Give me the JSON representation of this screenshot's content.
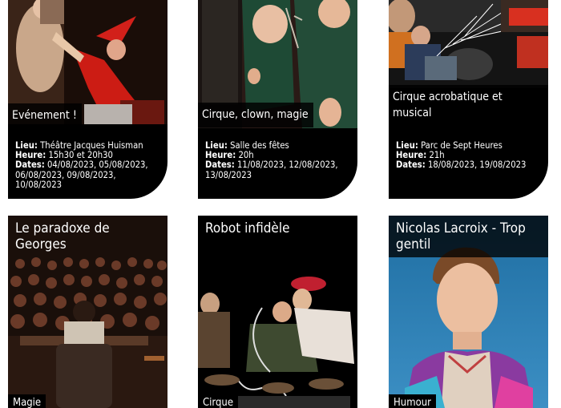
{
  "cards_top": [
    {
      "category": "Evénement !",
      "lieu_label": "Lieu:",
      "lieu": "Théâtre Jacques Huisman",
      "heure_label": "Heure:",
      "heure": "15h30 et 20h30",
      "dates_label": "Dates:",
      "dates": "04/08/2023, 05/08/2023, 06/08/2023, 09/08/2023, 10/08/2023"
    },
    {
      "category": "Cirque, clown, magie",
      "lieu_label": "Lieu:",
      "lieu": "Salle des fêtes",
      "heure_label": "Heure:",
      "heure": "20h",
      "dates_label": "Dates:",
      "dates": "11/08/2023, 12/08/2023, 13/08/2023"
    },
    {
      "category": "Cirque acrobatique et musical",
      "lieu_label": "Lieu:",
      "lieu": "Parc de Sept Heures",
      "heure_label": "Heure:",
      "heure": "21h",
      "dates_label": "Dates:",
      "dates": "18/08/2023, 19/08/2023"
    }
  ],
  "cards_bottom": [
    {
      "title": "Le paradoxe de Georges",
      "category": "Magie"
    },
    {
      "title": "Robot infidèle",
      "category": "Cirque"
    },
    {
      "title": "Nicolas Lacroix - Trop gentil",
      "category": "Humour"
    }
  ],
  "colors": {
    "card_bg": "#000000",
    "page_bg": "#ffffff",
    "text": "#ffffff"
  }
}
